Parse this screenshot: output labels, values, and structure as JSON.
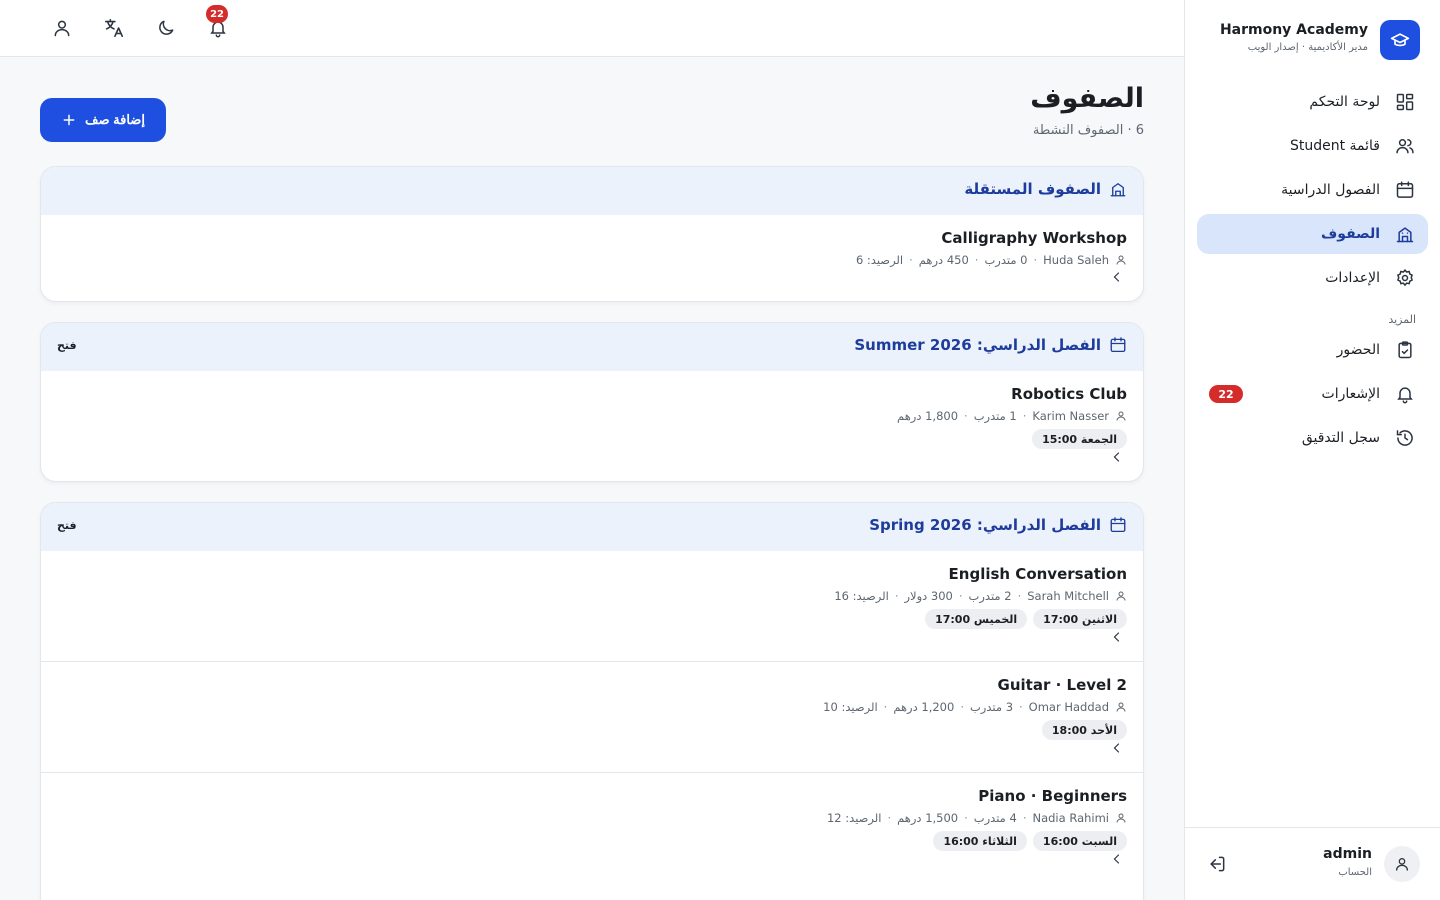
{
  "brand": {
    "name": "Harmony Academy",
    "subtitle": "مدير الأكاديمية · إصدار الويب"
  },
  "sidebar": {
    "items": [
      {
        "label": "لوحة التحكم",
        "icon": "dashboard-icon"
      },
      {
        "label": "قائمة Student",
        "icon": "users-icon"
      },
      {
        "label": "الفصول الدراسية",
        "icon": "calendar-icon"
      },
      {
        "label": "الصفوف",
        "icon": "school-icon",
        "active": true
      },
      {
        "label": "الإعدادات",
        "icon": "gear-icon"
      }
    ],
    "more_label": "المزيد",
    "more_items": [
      {
        "label": "الحضور",
        "icon": "clipboard-icon"
      },
      {
        "label": "الإشعارات",
        "icon": "bell-icon",
        "badge": "22"
      },
      {
        "label": "سجل التدقيق",
        "icon": "history-icon"
      }
    ]
  },
  "account": {
    "name": "admin",
    "subtitle": "الحساب"
  },
  "topbar": {
    "notifications_count": "22"
  },
  "page": {
    "title": "الصفوف",
    "subtitle": "6 · الصفوف النشطة",
    "add_button": "إضافة صف"
  },
  "groups": [
    {
      "title": "الصفوف المستقلة",
      "icon": "school-icon",
      "open_label": "",
      "rows": [
        {
          "name": "Calligraphy Workshop",
          "meta": [
            "Huda Saleh",
            "0 متدرب",
            "450 درهم",
            "الرصيد: 6"
          ],
          "chips": []
        }
      ]
    },
    {
      "title": "الفصل الدراسي: Summer 2026",
      "icon": "calendar-icon",
      "open_label": "فتح",
      "rows": [
        {
          "name": "Robotics Club",
          "meta": [
            "Karim Nasser",
            "1 متدرب",
            "1,800 درهم"
          ],
          "chips": [
            "الجمعة 15:00"
          ]
        }
      ]
    },
    {
      "title": "الفصل الدراسي: Spring 2026",
      "icon": "calendar-icon",
      "open_label": "فتح",
      "rows": [
        {
          "name": "English Conversation",
          "meta": [
            "Sarah Mitchell",
            "2 متدرب",
            "300 دولار",
            "الرصيد: 16"
          ],
          "chips": [
            "الاثنين 17:00",
            "الخميس 17:00"
          ]
        },
        {
          "name": "Guitar · Level 2",
          "meta": [
            "Omar Haddad",
            "3 متدرب",
            "1,200 درهم",
            "الرصيد: 10"
          ],
          "chips": [
            "الأحد 18:00"
          ]
        },
        {
          "name": "Piano · Beginners",
          "meta": [
            "Nadia Rahimi",
            "4 متدرب",
            "1,500 درهم",
            "الرصيد: 12"
          ],
          "chips": [
            "السبت 16:00",
            "الثلاثاء 16:00"
          ]
        }
      ]
    }
  ],
  "colors": {
    "accent": "#1f4fe0",
    "active_nav_bg": "#d9e5fb",
    "group_header_bg": "#ecf2fc",
    "badge": "#d42b2b"
  }
}
